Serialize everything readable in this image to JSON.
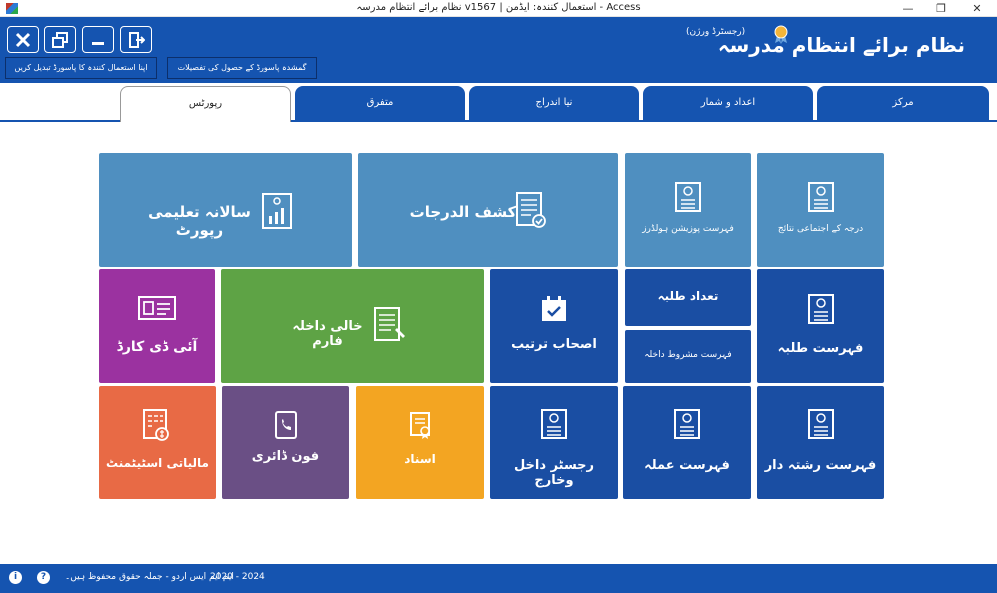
{
  "window": {
    "title": "Access - استعمال کنندہ: ایڈمن   |   v1567  نظام برائے انتظام مدرسہ",
    "minimize_glyph": "—",
    "restore_glyph": "❐",
    "close_glyph": "✕"
  },
  "header": {
    "brand_title": "نظام برائے انتظام مدرسہ",
    "brand_subtitle": "(رجسٹرڈ ورژن)",
    "change_password_link": "اپنا استعمال کنندہ کا پاسورڈ تبدیل کریں",
    "forgot_password_link": "گمشدہ پاسورڈ کے حصول کی تفصیلات"
  },
  "tabs": [
    {
      "label": "مرکز",
      "active": false
    },
    {
      "label": "اعداد و شمار",
      "active": false
    },
    {
      "label": "نیا اندراج",
      "active": false
    },
    {
      "label": "متفرق",
      "active": false
    },
    {
      "label": "رپورٹس",
      "active": true
    }
  ],
  "tiles": {
    "annual_report": "سالانہ تعلیمی رپورٹ",
    "marksheet": "کشف الدرجات",
    "position_holders": "فہرست پوزیشن ہولڈرز",
    "class_results": "درجہ کے اجتماعی نتائج",
    "id_card": "آئی ڈی کارڈ",
    "blank_admission_form": "خالی داخلہ فارم",
    "ashab_tarteeb": "اصحاب ترتیب",
    "student_count": "تعداد طلبہ",
    "conditional_admission": "فہرست مشروط داخلہ",
    "student_list": "فہرست طلبہ",
    "financial_statement": "مالیاتی اسٹیٹمنٹ",
    "phone_diary": "فون ڈائری",
    "certificate": "اسناد",
    "admission_register": "رجسٹر داخل وخارج",
    "staff_list": "فہرست عملہ",
    "relatives_list": "فہرست رشتہ دار"
  },
  "footer": {
    "copyright": "ایم ایم ایس اردو - جملہ حقوق محفوظ ہیں۔",
    "years": "2020 - 2024"
  },
  "colors": {
    "header_blue": "#1554b0",
    "tile_steel": "#4f8fc0",
    "tile_navy": "#1a4ea3",
    "tile_purple": "#9b32a0",
    "tile_green": "#5ea345",
    "tile_orange": "#e86a45",
    "tile_plum": "#6a4f85",
    "tile_amber": "#f3a522"
  },
  "icons": [
    "app-icon",
    "close-icon",
    "restore-icon",
    "minimize-icon",
    "exit-icon",
    "badge-icon",
    "report-book-icon",
    "marksheet-icon",
    "certificate-doc-icon",
    "id-card-icon",
    "form-icon",
    "calendar-check-icon",
    "finance-icon",
    "phone-book-icon",
    "certificate-icon",
    "info-icon",
    "help-icon"
  ]
}
